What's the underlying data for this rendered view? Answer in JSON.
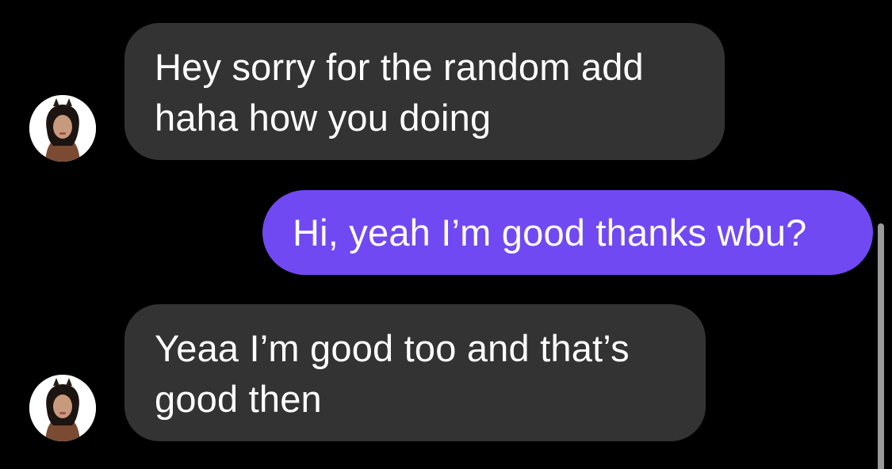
{
  "thread": {
    "messages": [
      {
        "direction": "incoming",
        "text": "Hey sorry for the random add haha how you doing"
      },
      {
        "direction": "outgoing",
        "text": "Hi, yeah I’m good thanks wbu?"
      },
      {
        "direction": "incoming",
        "text": "Yeaa I’m good too and that’s good then"
      }
    ]
  },
  "colors": {
    "background": "#000000",
    "incoming_bubble": "#333333",
    "outgoing_bubble": "#7149f2",
    "text": "#ffffff"
  },
  "icons": {
    "contact_avatar": "contact-avatar-photo",
    "scrollbar": "scrollbar"
  }
}
